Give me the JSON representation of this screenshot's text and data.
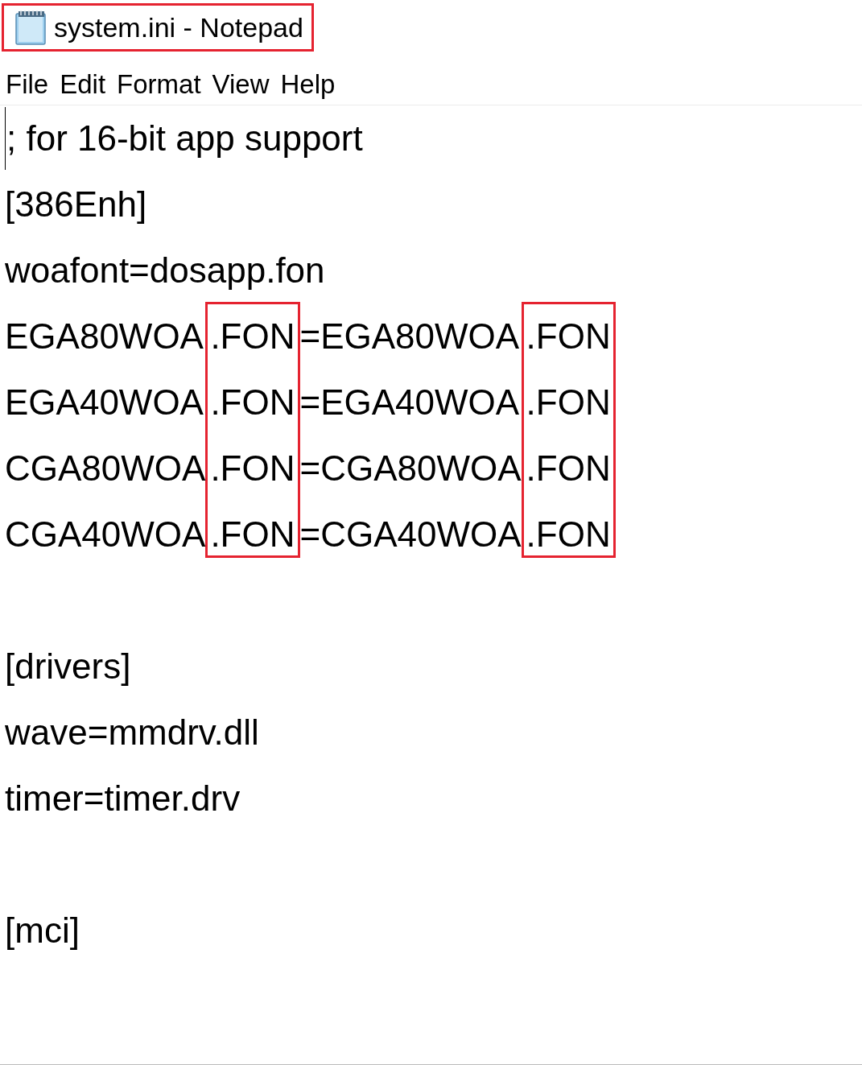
{
  "window": {
    "title": "system.ini - Notepad",
    "title_highlighted": true
  },
  "menu": [
    "File",
    "Edit",
    "Format",
    "View",
    "Help"
  ],
  "editor": {
    "blocks": [
      {
        "kind": "text",
        "text": "; for 16-bit app support",
        "caret": true
      },
      {
        "kind": "text",
        "text": "[386Enh]"
      },
      {
        "kind": "text",
        "text": "woafont=dosapp.fon"
      },
      {
        "kind": "table",
        "column_highlighted": [
          false,
          true,
          false,
          true
        ],
        "rows": [
          [
            "EGA80WOA",
            ".FON",
            "=EGA80WOA",
            ".FON"
          ],
          [
            "EGA40WOA",
            ".FON",
            "=EGA40WOA",
            ".FON"
          ],
          [
            "CGA80WOA",
            ".FON",
            "=CGA80WOA",
            ".FON"
          ],
          [
            "CGA40WOA",
            ".FON",
            "=CGA40WOA",
            ".FON"
          ]
        ]
      },
      {
        "kind": "blank"
      },
      {
        "kind": "text",
        "text": "[drivers]"
      },
      {
        "kind": "text",
        "text": "wave=mmdrv.dll"
      },
      {
        "kind": "text",
        "text": "timer=timer.drv"
      },
      {
        "kind": "blank"
      },
      {
        "kind": "text",
        "text": "[mci]"
      }
    ]
  }
}
